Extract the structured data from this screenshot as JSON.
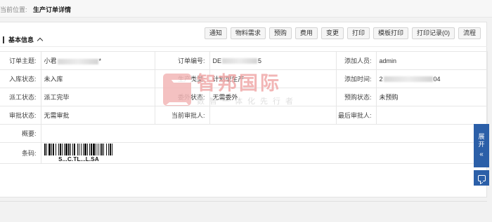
{
  "breadcrumb": {
    "label": "当前位置:",
    "title": "生产订单详情"
  },
  "toolbar": {
    "buttons": [
      "通知",
      "物料需求",
      "预购",
      "费用",
      "变更",
      "打印",
      "模板打印",
      "打印记录(0)",
      "流程"
    ]
  },
  "section": {
    "title": "基本信息"
  },
  "info": {
    "r1": {
      "l1": "订单主题:",
      "v1": "小君",
      "v1_tail": "*",
      "l2": "订单编号:",
      "v2": "DE",
      "v2_tail": "5",
      "l3": "添加人员:",
      "v3": "admin"
    },
    "r2": {
      "l1": "入库状态:",
      "v1": "未入库",
      "l2": "生产类型:",
      "v2": "计划型生产",
      "l3": "添加时间:",
      "v3": "2",
      "v3_tail": "04"
    },
    "r3": {
      "l1": "派工状态:",
      "v1": "派工完毕",
      "l2": "委外状态:",
      "v2": "无需委外",
      "l3": "预购状态:",
      "v3": "未预购"
    },
    "r4": {
      "l1": "审批状态:",
      "v1": "无需审批",
      "l2": "当前审批人:",
      "v2": "",
      "l3": "最后审批人:",
      "v3": ""
    },
    "r5": {
      "l1": "概要:",
      "v1": ""
    },
    "r6": {
      "l1": "条码:",
      "barcode_text": "S...C.TL...L.SA"
    }
  },
  "watermark": {
    "title": "智邦国际",
    "subtitle": "数智一体化先行者"
  },
  "side": {
    "open_label_1": "展",
    "open_label_2": "开",
    "chevron": "«"
  },
  "colors": {
    "accent": "#2b5fa8",
    "watermark": "#f0a9a9"
  }
}
